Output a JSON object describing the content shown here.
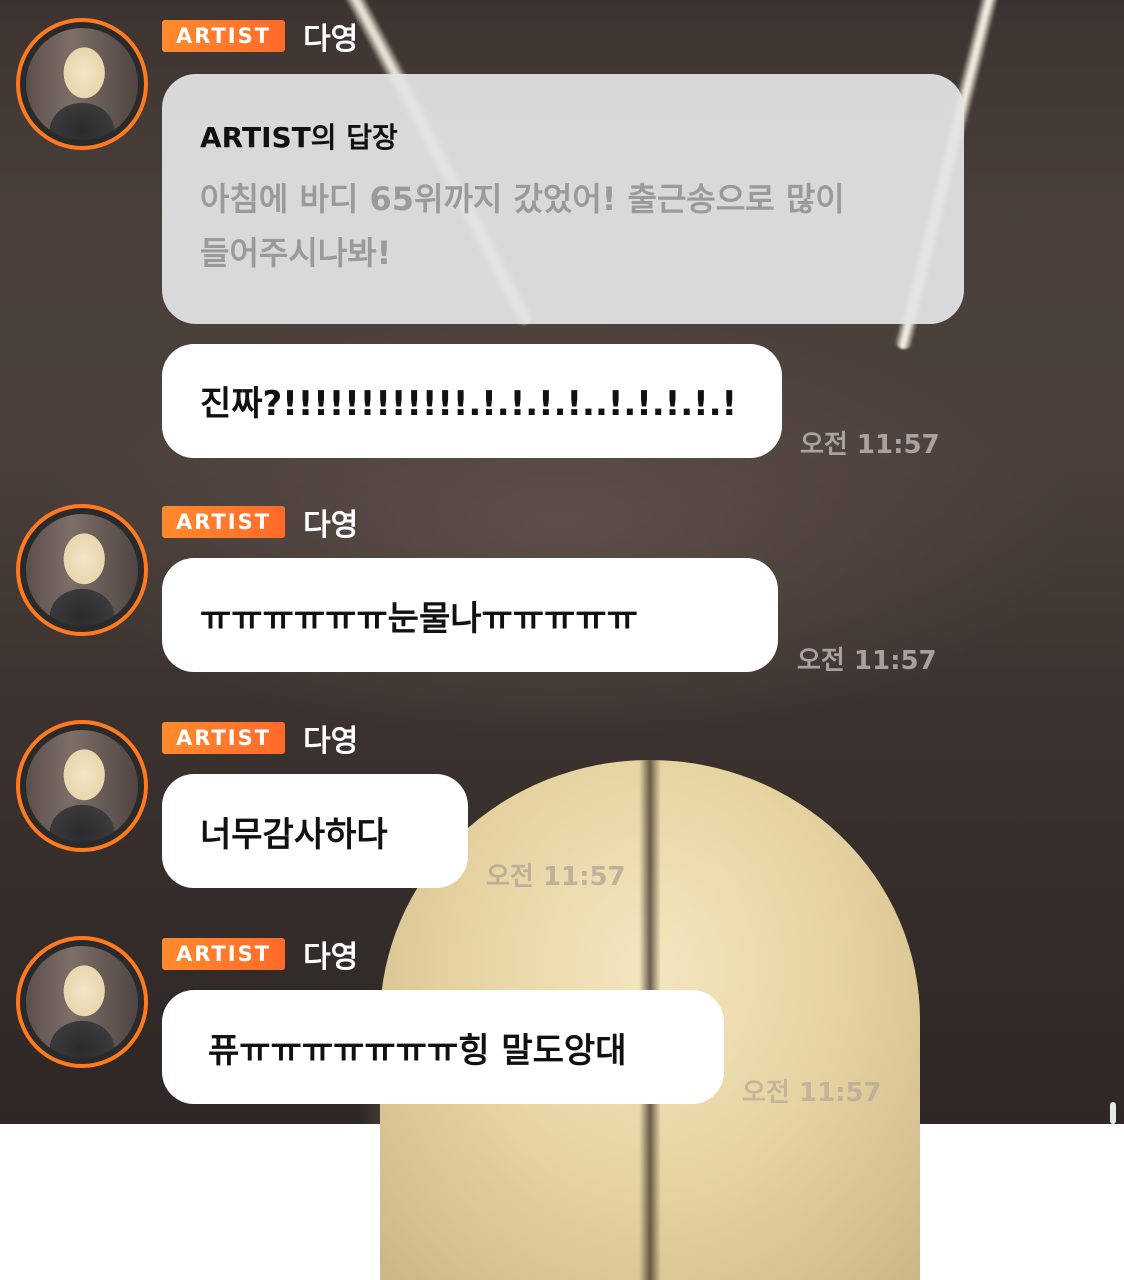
{
  "chat": {
    "messages": [
      {
        "badge": "ARTIST",
        "sender": "다영",
        "reply": {
          "header": "ARTIST의 답장",
          "body_line1": "아침에 바디 65위까지 갔었어! 출근송으로 많이",
          "body_line2": "들어주시나봐!"
        },
        "text": "진짜?!!!!!!!!!!!!.!.!.!.!..!.!.!.!.!",
        "time": "오전 11:57"
      },
      {
        "badge": "ARTIST",
        "sender": "다영",
        "text": "ㅠㅠㅠㅠㅠㅠ눈물나ㅠㅠㅠㅠㅠ",
        "time": "오전 11:57"
      },
      {
        "badge": "ARTIST",
        "sender": "다영",
        "text": "너무감사하다",
        "time": "오전 11:57"
      },
      {
        "badge": "ARTIST",
        "sender": "다영",
        "text": "퓨ㅠㅠㅠㅠㅠㅠㅠ힝 말도앙대",
        "time": "오전 11:57"
      }
    ]
  },
  "colors": {
    "badge": "#ff7a2a",
    "avatar_ring": "#ff7a1f",
    "bubble": "#ffffff",
    "reply_card": "#e4e4e6"
  }
}
